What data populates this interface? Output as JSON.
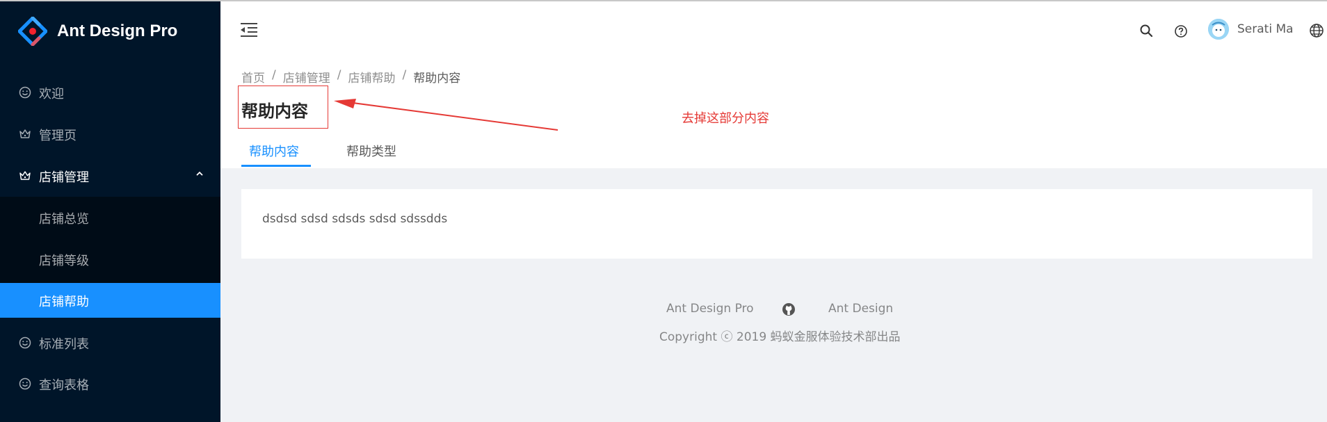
{
  "app": {
    "title": "Ant Design Pro"
  },
  "sidebar": {
    "items": [
      {
        "label": "欢迎",
        "icon": "smile-icon"
      },
      {
        "label": "管理页",
        "icon": "crown-icon"
      },
      {
        "label": "店铺管理",
        "icon": "crown-icon",
        "open": true,
        "children": [
          {
            "label": "店铺总览"
          },
          {
            "label": "店铺等级"
          },
          {
            "label": "店铺帮助",
            "selected": true
          }
        ]
      },
      {
        "label": "标准列表",
        "icon": "smile-icon"
      },
      {
        "label": "查询表格",
        "icon": "smile-icon"
      }
    ]
  },
  "header": {
    "user_name": "Serati Ma",
    "icons": [
      "menu-fold-icon",
      "search-icon",
      "question-circle-icon",
      "avatar",
      "global-icon"
    ]
  },
  "breadcrumb": [
    "首页",
    "店铺管理",
    "店铺帮助",
    "帮助内容"
  ],
  "page": {
    "title": "帮助内容",
    "annotation": "去掉这部分内容",
    "tabs": [
      {
        "label": "帮助内容",
        "active": true
      },
      {
        "label": "帮助类型",
        "active": false
      }
    ]
  },
  "content": {
    "text": "dsdsd sdsd sdsds sdsd sdssdds"
  },
  "footer": {
    "links": [
      "Ant Design Pro",
      "Ant Design"
    ],
    "copyright": "Copyright ⓒ 2019 蚂蚁金服体验技术部出品"
  },
  "colors": {
    "sider": "#001529",
    "submenu": "#000c17",
    "primary": "#1890ff",
    "annotation": "#e53935"
  }
}
